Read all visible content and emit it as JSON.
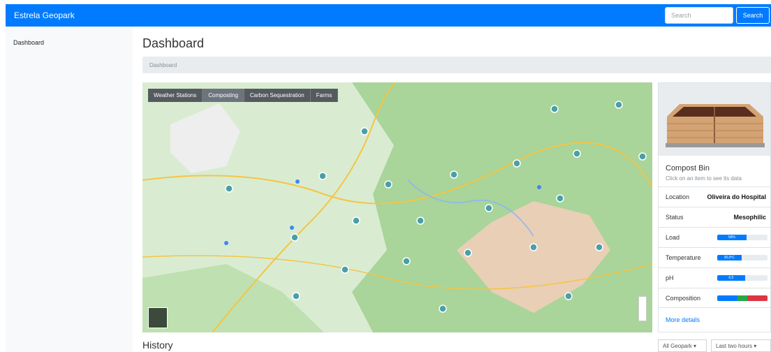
{
  "navbar": {
    "brand": "Estrela Geopark",
    "search_placeholder": "Search",
    "search_label": "Search"
  },
  "sidebar": {
    "items": [
      {
        "label": "Dashboard"
      }
    ]
  },
  "main": {
    "title": "Dashboard",
    "breadcrumb": "Dashboard",
    "history_title": "History"
  },
  "map": {
    "tabs": [
      {
        "label": "Weather Stations"
      },
      {
        "label": "Composting"
      },
      {
        "label": "Carbon Sequestration"
      },
      {
        "label": "Farms"
      }
    ],
    "active_tab": "Composting",
    "colors": {
      "land": "#d9ecd2",
      "forest": "#a9d49a",
      "urban": "#eeeeee",
      "burned": "#e9cfb6",
      "road": "#f4c542",
      "marker": "#4a9fa8"
    }
  },
  "card": {
    "title": "Compost Bin",
    "subtitle": "Click on an item to see its data",
    "rows": [
      {
        "label": "Location",
        "value": "Oliveira do Hospital"
      },
      {
        "label": "Status",
        "value": "Mesophilic"
      },
      {
        "label": "Load",
        "bar_label": "58%",
        "bar_value": 58
      },
      {
        "label": "Temperature",
        "bar_label": "30,0ºC",
        "bar_value": 48
      },
      {
        "label": "pH",
        "bar_label": "6.5",
        "bar_value": 55
      },
      {
        "label": "Composition"
      }
    ],
    "composition": [
      {
        "value": 40,
        "color": "#007bff"
      },
      {
        "value": 20,
        "color": "#28a745"
      },
      {
        "value": 40,
        "color": "#dc3545"
      }
    ],
    "more_link": "More details"
  },
  "filters": {
    "region": "All Geopark",
    "period": "Last two hours"
  }
}
